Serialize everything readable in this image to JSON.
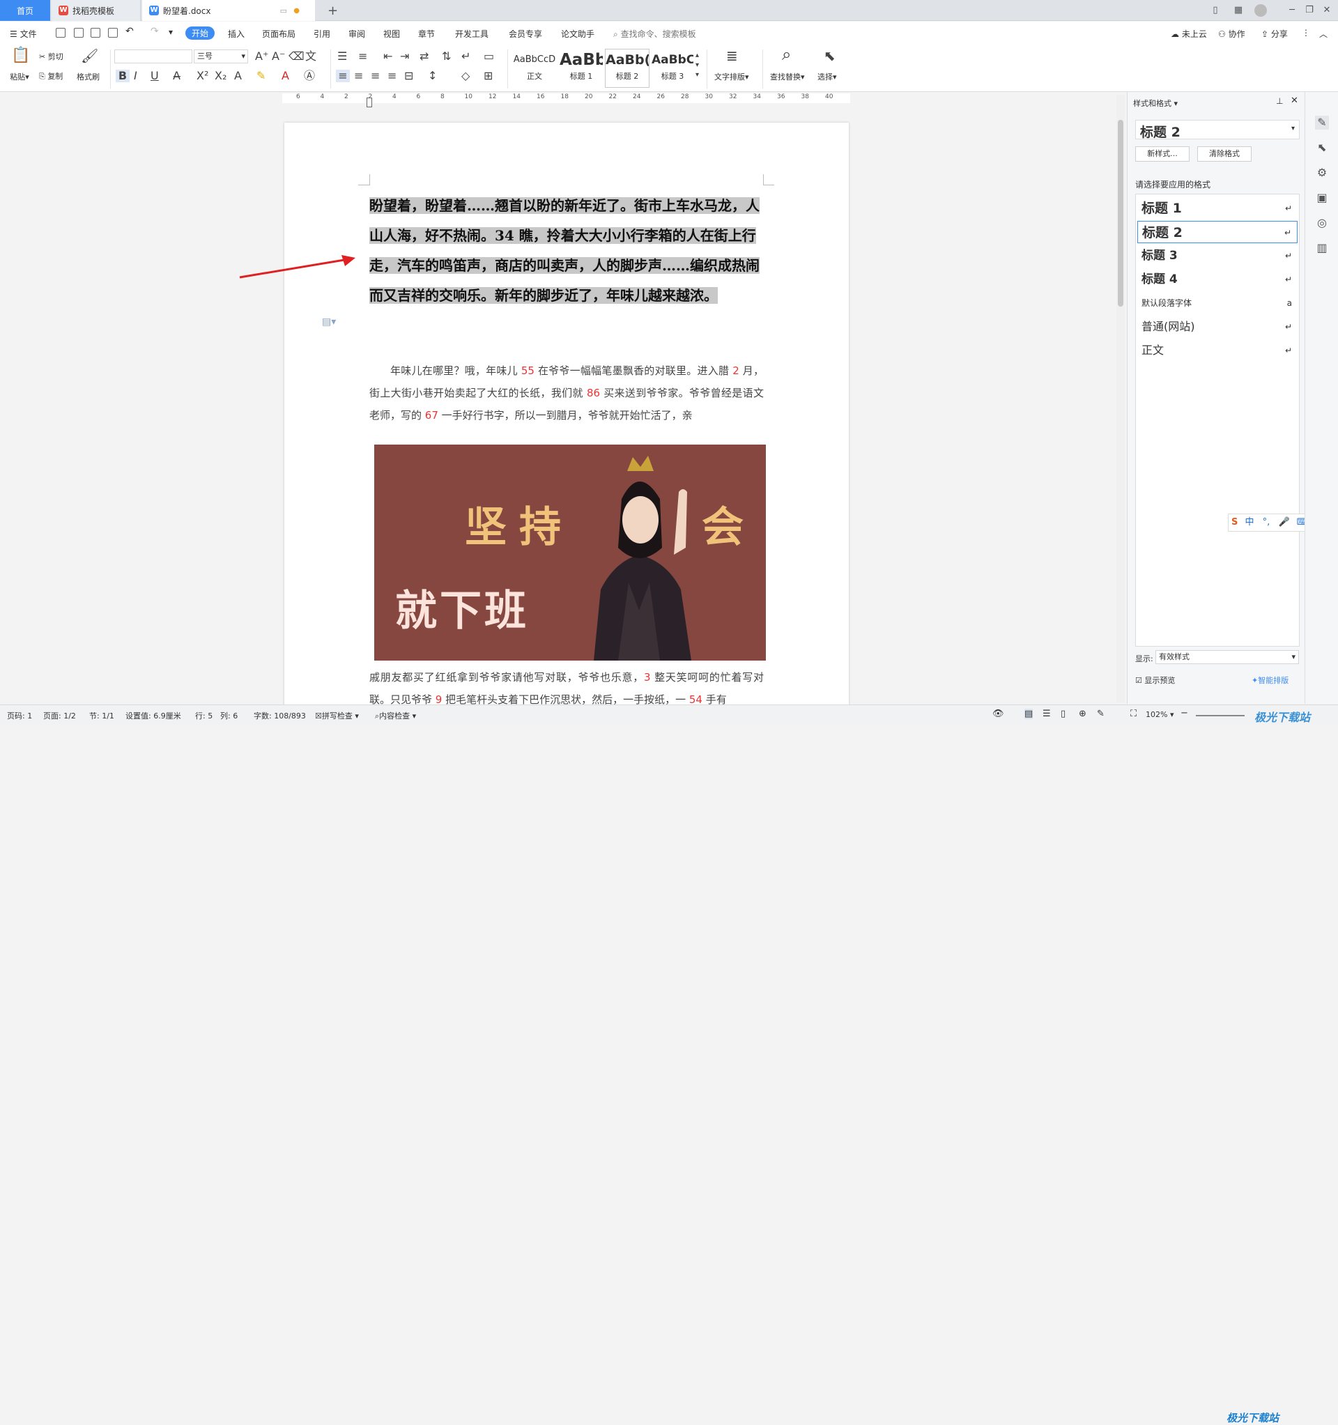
{
  "tabs": {
    "home": "首页",
    "template": "找稻壳模板",
    "doc": "盼望着.docx"
  },
  "menu": {
    "file": "文件",
    "items": [
      "开始",
      "插入",
      "页面布局",
      "引用",
      "审阅",
      "视图",
      "章节",
      "开发工具",
      "会员专享",
      "论文助手"
    ],
    "search_placeholder": "查找命令、搜索模板",
    "cloud": "未上云",
    "collab": "协作",
    "share": "分享"
  },
  "ribbon": {
    "paste": "粘贴",
    "cut": "剪切",
    "copy": "复制",
    "format_painter": "格式刷",
    "font_name": "",
    "font_size": "三号",
    "styles": [
      {
        "preview": "AaBbCcD",
        "label": "正文"
      },
      {
        "preview": "AaBb",
        "label": "标题 1"
      },
      {
        "preview": "AaBb(",
        "label": "标题 2"
      },
      {
        "preview": "AaBbC(",
        "label": "标题 3"
      }
    ],
    "text_layout": "文字排版",
    "find_replace": "查找替换",
    "select": "选择"
  },
  "ruler_marks": [
    "6",
    "4",
    "2",
    "2",
    "4",
    "6",
    "8",
    "10",
    "12",
    "14",
    "16",
    "18",
    "20",
    "22",
    "24",
    "26",
    "28",
    "30",
    "32",
    "34",
    "36",
    "38",
    "40"
  ],
  "document": {
    "heading": "盼望着，盼望着……翘首以盼的新年近了。街市上车水马龙，人山人海，好不热闹。34 瞧，拎着大大小小行李箱的人在街上行走，汽车的鸣笛声，商店的叫卖声，人的脚步声……编织成热闹而又吉祥的交响乐。新年的脚步近了，年味儿越来越浓。",
    "para1": [
      {
        "t": "年味儿在哪里？哦，年味儿 "
      },
      {
        "t": "55",
        "red": true
      },
      {
        "t": " 在爷爷一幅幅笔墨飘香的对联里。进入腊 "
      },
      {
        "t": "2",
        "red": true
      },
      {
        "t": " 月，街上大街小巷开始卖起了大红的长纸，我们就 "
      },
      {
        "t": "86",
        "red": true
      },
      {
        "t": " 买来送到爷爷家。爷爷曾经是语文老师，写的 "
      },
      {
        "t": "67",
        "red": true
      },
      {
        "t": " 一手好行书字，所以一到腊月，爷爷就开始忙活了，亲"
      }
    ],
    "para2": [
      {
        "t": "戚朋友都买了红纸拿到爷爷家请他写对联，爷爷也乐意，"
      },
      {
        "t": "3",
        "red": true
      },
      {
        "t": " 整天笑呵呵的忙着写对联。只见爷爷 "
      },
      {
        "t": "9",
        "red": true
      },
      {
        "t": " 把毛笔杆头支着下巴作沉思状，然后，一手按纸，一 "
      },
      {
        "t": "54",
        "red": true
      },
      {
        "t": " 手有"
      }
    ],
    "image_text": {
      "left_top": "坚持",
      "right_top": "会",
      "bottom": "就下班"
    }
  },
  "panel": {
    "title": "样式和格式",
    "current": "标题  2",
    "new_style": "新样式...",
    "clear_format": "清除格式",
    "prompt": "请选择要应用的格式",
    "styles": [
      {
        "name": "标题  1",
        "weight": "bold",
        "size": 19,
        "mark": "↵"
      },
      {
        "name": "标题  2",
        "weight": "bold",
        "size": 19,
        "mark": "↵",
        "selected": true
      },
      {
        "name": "标题  3",
        "weight": "bold",
        "size": 17,
        "mark": "↵"
      },
      {
        "name": "标题  4",
        "weight": "bold",
        "size": 17,
        "mark": "↵"
      },
      {
        "name": "默认段落字体",
        "weight": "normal",
        "size": 12,
        "mark": "a"
      },
      {
        "name": "普通(网站)",
        "weight": "normal",
        "size": 16,
        "mark": "↵"
      },
      {
        "name": "正文",
        "weight": "normal",
        "size": 16,
        "mark": "↵"
      }
    ],
    "show_label": "显示:",
    "show_value": "有效样式",
    "preview_label": "显示预览",
    "smart_layout": "智能排版"
  },
  "ime": {
    "label": "中"
  },
  "status": {
    "page_num": "页码: 1",
    "pages": "页面: 1/2",
    "section": "节: 1/1",
    "setting": "设置值: 6.9厘米",
    "row": "行: 5",
    "col": "列: 6",
    "words": "字数: 108/893",
    "spell": "拼写检查",
    "content_check": "内容检查",
    "zoom": "102%"
  },
  "watermark": "极光下载站",
  "colors": {
    "accent": "#3d8cf4",
    "selection": "#c8c8c8",
    "red_num": "#e33",
    "image_bg": "#85473f",
    "image_text": "#f0c27a"
  }
}
